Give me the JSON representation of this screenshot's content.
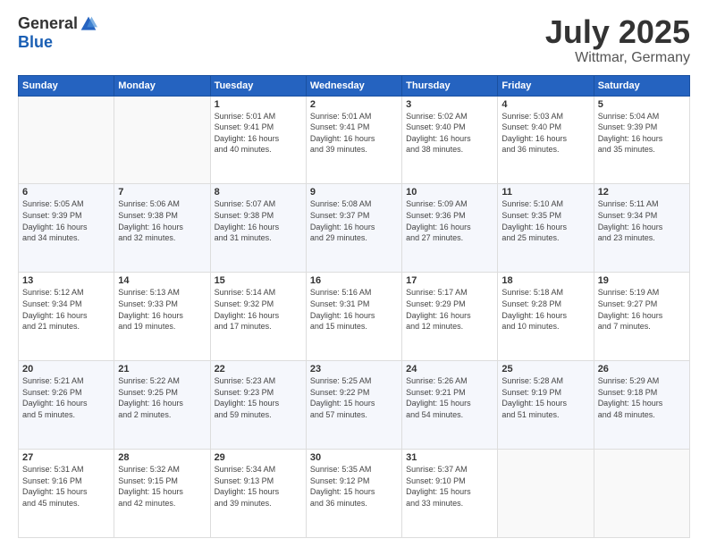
{
  "logo": {
    "general": "General",
    "blue": "Blue"
  },
  "header": {
    "month": "July 2025",
    "location": "Wittmar, Germany"
  },
  "weekdays": [
    "Sunday",
    "Monday",
    "Tuesday",
    "Wednesday",
    "Thursday",
    "Friday",
    "Saturday"
  ],
  "weeks": [
    [
      {
        "day": "",
        "info": ""
      },
      {
        "day": "",
        "info": ""
      },
      {
        "day": "1",
        "info": "Sunrise: 5:01 AM\nSunset: 9:41 PM\nDaylight: 16 hours\nand 40 minutes."
      },
      {
        "day": "2",
        "info": "Sunrise: 5:01 AM\nSunset: 9:41 PM\nDaylight: 16 hours\nand 39 minutes."
      },
      {
        "day": "3",
        "info": "Sunrise: 5:02 AM\nSunset: 9:40 PM\nDaylight: 16 hours\nand 38 minutes."
      },
      {
        "day": "4",
        "info": "Sunrise: 5:03 AM\nSunset: 9:40 PM\nDaylight: 16 hours\nand 36 minutes."
      },
      {
        "day": "5",
        "info": "Sunrise: 5:04 AM\nSunset: 9:39 PM\nDaylight: 16 hours\nand 35 minutes."
      }
    ],
    [
      {
        "day": "6",
        "info": "Sunrise: 5:05 AM\nSunset: 9:39 PM\nDaylight: 16 hours\nand 34 minutes."
      },
      {
        "day": "7",
        "info": "Sunrise: 5:06 AM\nSunset: 9:38 PM\nDaylight: 16 hours\nand 32 minutes."
      },
      {
        "day": "8",
        "info": "Sunrise: 5:07 AM\nSunset: 9:38 PM\nDaylight: 16 hours\nand 31 minutes."
      },
      {
        "day": "9",
        "info": "Sunrise: 5:08 AM\nSunset: 9:37 PM\nDaylight: 16 hours\nand 29 minutes."
      },
      {
        "day": "10",
        "info": "Sunrise: 5:09 AM\nSunset: 9:36 PM\nDaylight: 16 hours\nand 27 minutes."
      },
      {
        "day": "11",
        "info": "Sunrise: 5:10 AM\nSunset: 9:35 PM\nDaylight: 16 hours\nand 25 minutes."
      },
      {
        "day": "12",
        "info": "Sunrise: 5:11 AM\nSunset: 9:34 PM\nDaylight: 16 hours\nand 23 minutes."
      }
    ],
    [
      {
        "day": "13",
        "info": "Sunrise: 5:12 AM\nSunset: 9:34 PM\nDaylight: 16 hours\nand 21 minutes."
      },
      {
        "day": "14",
        "info": "Sunrise: 5:13 AM\nSunset: 9:33 PM\nDaylight: 16 hours\nand 19 minutes."
      },
      {
        "day": "15",
        "info": "Sunrise: 5:14 AM\nSunset: 9:32 PM\nDaylight: 16 hours\nand 17 minutes."
      },
      {
        "day": "16",
        "info": "Sunrise: 5:16 AM\nSunset: 9:31 PM\nDaylight: 16 hours\nand 15 minutes."
      },
      {
        "day": "17",
        "info": "Sunrise: 5:17 AM\nSunset: 9:29 PM\nDaylight: 16 hours\nand 12 minutes."
      },
      {
        "day": "18",
        "info": "Sunrise: 5:18 AM\nSunset: 9:28 PM\nDaylight: 16 hours\nand 10 minutes."
      },
      {
        "day": "19",
        "info": "Sunrise: 5:19 AM\nSunset: 9:27 PM\nDaylight: 16 hours\nand 7 minutes."
      }
    ],
    [
      {
        "day": "20",
        "info": "Sunrise: 5:21 AM\nSunset: 9:26 PM\nDaylight: 16 hours\nand 5 minutes."
      },
      {
        "day": "21",
        "info": "Sunrise: 5:22 AM\nSunset: 9:25 PM\nDaylight: 16 hours\nand 2 minutes."
      },
      {
        "day": "22",
        "info": "Sunrise: 5:23 AM\nSunset: 9:23 PM\nDaylight: 15 hours\nand 59 minutes."
      },
      {
        "day": "23",
        "info": "Sunrise: 5:25 AM\nSunset: 9:22 PM\nDaylight: 15 hours\nand 57 minutes."
      },
      {
        "day": "24",
        "info": "Sunrise: 5:26 AM\nSunset: 9:21 PM\nDaylight: 15 hours\nand 54 minutes."
      },
      {
        "day": "25",
        "info": "Sunrise: 5:28 AM\nSunset: 9:19 PM\nDaylight: 15 hours\nand 51 minutes."
      },
      {
        "day": "26",
        "info": "Sunrise: 5:29 AM\nSunset: 9:18 PM\nDaylight: 15 hours\nand 48 minutes."
      }
    ],
    [
      {
        "day": "27",
        "info": "Sunrise: 5:31 AM\nSunset: 9:16 PM\nDaylight: 15 hours\nand 45 minutes."
      },
      {
        "day": "28",
        "info": "Sunrise: 5:32 AM\nSunset: 9:15 PM\nDaylight: 15 hours\nand 42 minutes."
      },
      {
        "day": "29",
        "info": "Sunrise: 5:34 AM\nSunset: 9:13 PM\nDaylight: 15 hours\nand 39 minutes."
      },
      {
        "day": "30",
        "info": "Sunrise: 5:35 AM\nSunset: 9:12 PM\nDaylight: 15 hours\nand 36 minutes."
      },
      {
        "day": "31",
        "info": "Sunrise: 5:37 AM\nSunset: 9:10 PM\nDaylight: 15 hours\nand 33 minutes."
      },
      {
        "day": "",
        "info": ""
      },
      {
        "day": "",
        "info": ""
      }
    ]
  ]
}
